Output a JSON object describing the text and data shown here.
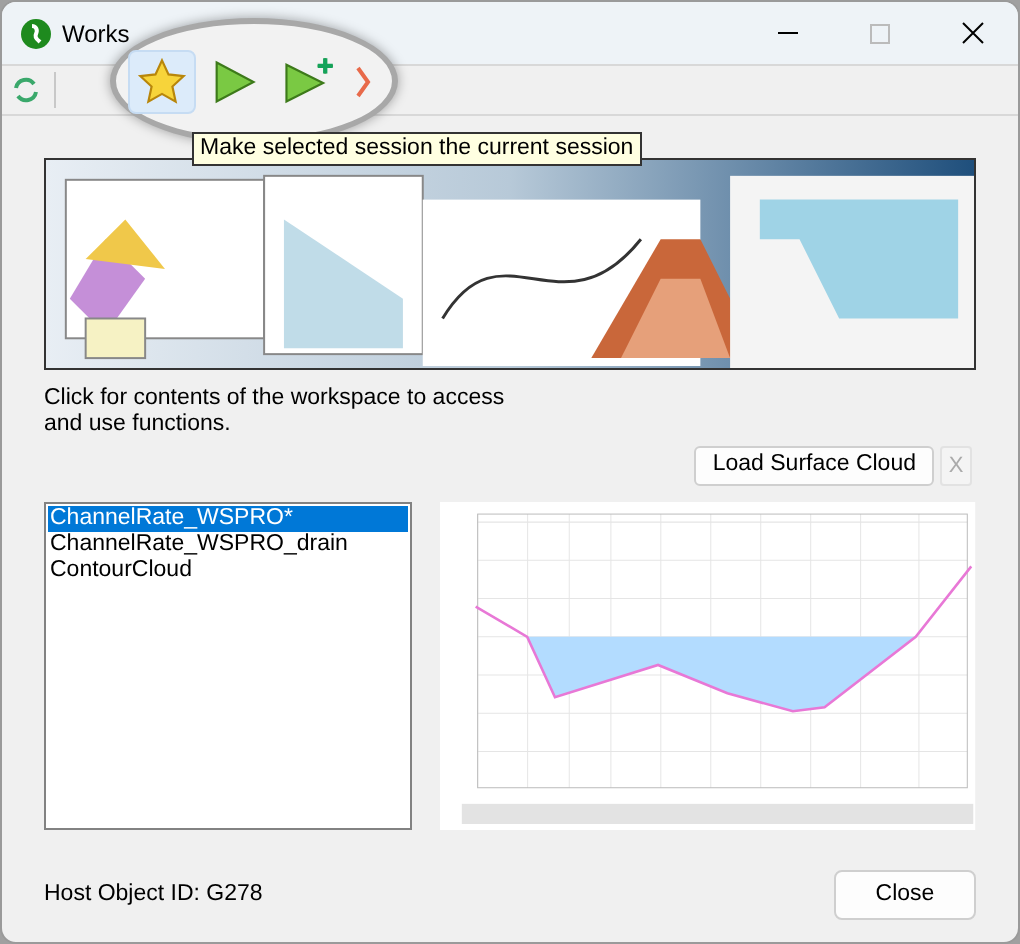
{
  "window": {
    "title": "Works"
  },
  "toolbar": {
    "magnified_tools": [
      {
        "kind": "star",
        "selected": true
      },
      {
        "kind": "play",
        "selected": false
      },
      {
        "kind": "play-add",
        "selected": false
      },
      {
        "kind": "partial",
        "selected": false
      }
    ]
  },
  "tooltip": "Make selected session the current session",
  "description": "Click for contents of the workspace to access and use functions.",
  "load_button": {
    "label": "Load Surface Cloud"
  },
  "clear_button": {
    "label": "X",
    "disabled": true
  },
  "sessions": [
    {
      "label": "ChannelRate_WSPRO*",
      "selected": true
    },
    {
      "label": "ChannelRate_WSPRO_drain",
      "selected": false
    },
    {
      "label": "ContourCloud",
      "selected": false
    }
  ],
  "host_object": "Host Object ID: G278",
  "close_button": {
    "label": "Close"
  }
}
